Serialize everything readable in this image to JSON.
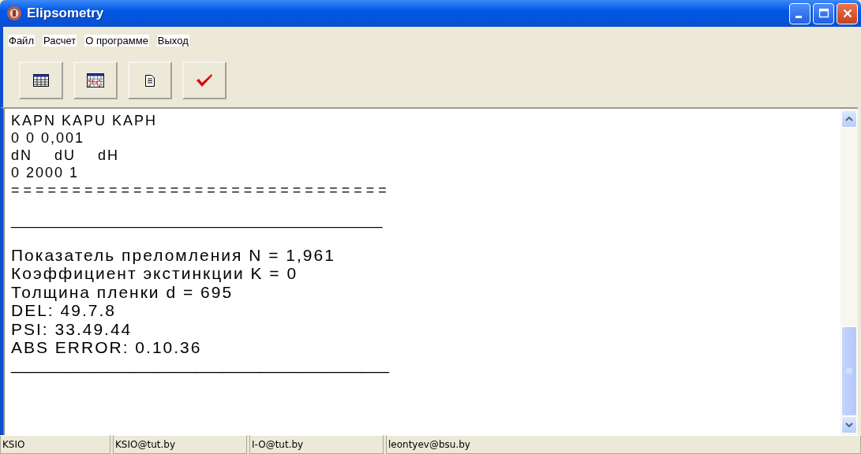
{
  "window": {
    "title": "Elipsometry"
  },
  "menu": [
    "Файл",
    "Расчет",
    "О программе",
    "Выход"
  ],
  "toolbar": [
    {
      "kind": "table"
    },
    {
      "kind": "calendar"
    },
    {
      "kind": "document"
    },
    {
      "kind": "check"
    }
  ],
  "output": {
    "header_lines": [
      "KAPN KAPU KAPH",
      "0 0 0,001",
      "dN    dU    dH",
      "0 2000 1",
      "===============================",
      "_______________________________________________"
    ],
    "result_lines": [
      "Показатель преломления N = 1,961",
      "Коэффициент экстинкции K = 0",
      "Толщина пленки d = 695",
      "DEL: 49.7.8",
      "PSI: 33.49.44",
      "ABS ERROR: 0.10.36",
      "_________________________________________"
    ]
  },
  "status_bar": [
    "KSIO",
    "KSIO@tut.by",
    "I-O@tut.by",
    "leontyev@bsu.by"
  ]
}
